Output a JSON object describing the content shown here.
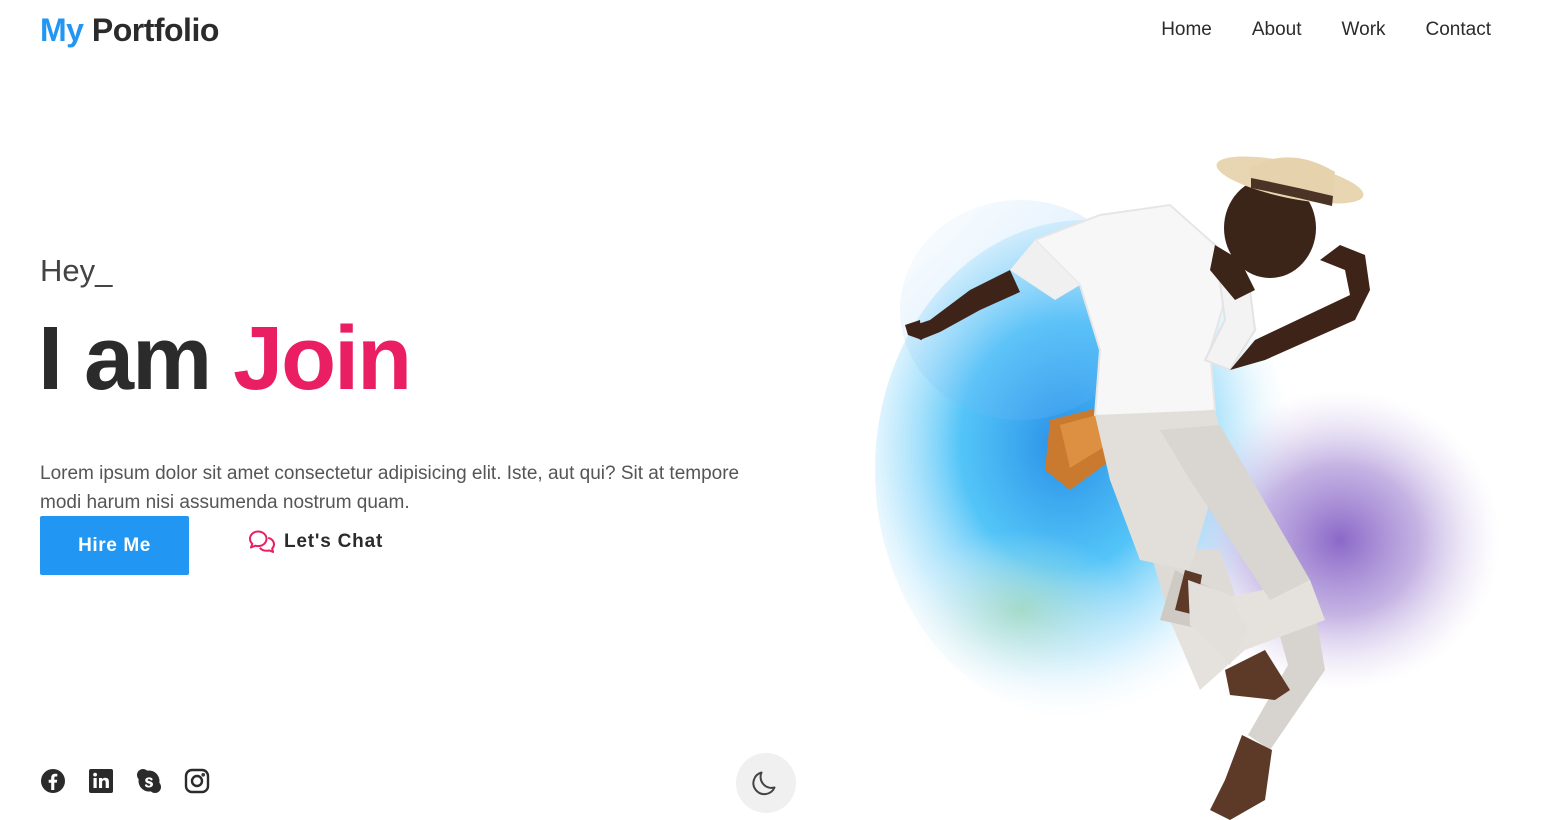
{
  "header": {
    "logo_accent": "My",
    "logo_rest": " Portfolio",
    "nav": [
      {
        "label": "Home"
      },
      {
        "label": "About"
      },
      {
        "label": "Work"
      },
      {
        "label": "Contact"
      }
    ]
  },
  "hero": {
    "greeting": "Hey_",
    "headline_prefix": "I am ",
    "headline_name": "Join",
    "description": "Lorem ipsum dolor sit amet consectetur adipisicing elit. Iste, aut qui? Sit at tempore modi harum nisi assumenda nostrum quam.",
    "hire_button": "Hire Me",
    "chat_button": "Let's Chat"
  },
  "social": {
    "icons": [
      "facebook-icon",
      "linkedin-icon",
      "skype-icon",
      "instagram-icon"
    ]
  },
  "theme_toggle": {
    "icon": "moon-icon"
  },
  "colors": {
    "accent_blue": "#2196f3",
    "accent_pink": "#e91e63",
    "text_dark": "#2b2b2b"
  }
}
